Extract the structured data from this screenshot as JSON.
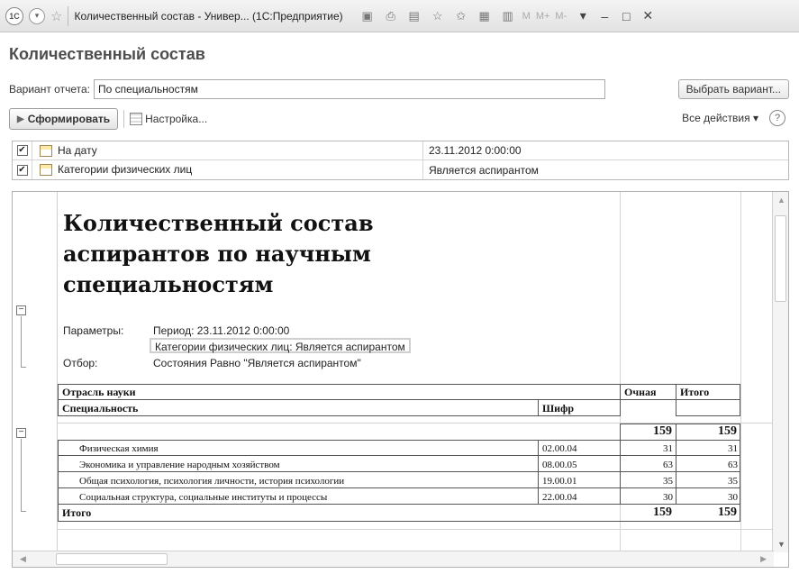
{
  "window": {
    "app_badge": "1C",
    "title": "Количественный состав - Универ... (1С:Предприятие)",
    "memory_buttons": [
      "M",
      "M+",
      "M-"
    ]
  },
  "heading": "Количественный состав",
  "variant": {
    "label": "Вариант отчета:",
    "value": "По специальностям",
    "choose_button": "Выбрать вариант..."
  },
  "commands": {
    "generate": "Сформировать",
    "settings": "Настройка...",
    "all_actions": "Все действия ▾",
    "help": "?"
  },
  "settings_rows": [
    {
      "checked": true,
      "name": "На дату",
      "value": "23.11.2012 0:00:00"
    },
    {
      "checked": true,
      "name": "Категории физических лиц",
      "value": "Является аспирантом"
    }
  ],
  "report": {
    "title": "Количественный состав аспирантов по научным специальностям",
    "params_label": "Параметры:",
    "params_period": "Период: 23.11.2012 0:00:00",
    "params_category": "Категории физических лиц: Является аспирантом",
    "filter_label": "Отбор:",
    "filter_value": "Состояния Равно \"Является аспирантом\"",
    "header": {
      "branch": "Отрасль науки",
      "specialty": "Специальность",
      "code": "Шифр",
      "fulltime": "Очная",
      "total": "Итого"
    },
    "group_totals": {
      "fulltime": "159",
      "total": "159"
    },
    "rows": [
      {
        "name": "Физическая химия",
        "code": "02.00.04",
        "fulltime": "31",
        "total": "31"
      },
      {
        "name": "Экономика и управление народным хозяйством",
        "code": "08.00.05",
        "fulltime": "63",
        "total": "63"
      },
      {
        "name": "Общая психология, психология личности, история психологии",
        "code": "19.00.01",
        "fulltime": "35",
        "total": "35"
      },
      {
        "name": "Социальная структура, социальные институты и процессы",
        "code": "22.00.04",
        "fulltime": "30",
        "total": "30"
      }
    ],
    "grand_total": {
      "label": "Итого",
      "fulltime": "159",
      "total": "159"
    }
  }
}
